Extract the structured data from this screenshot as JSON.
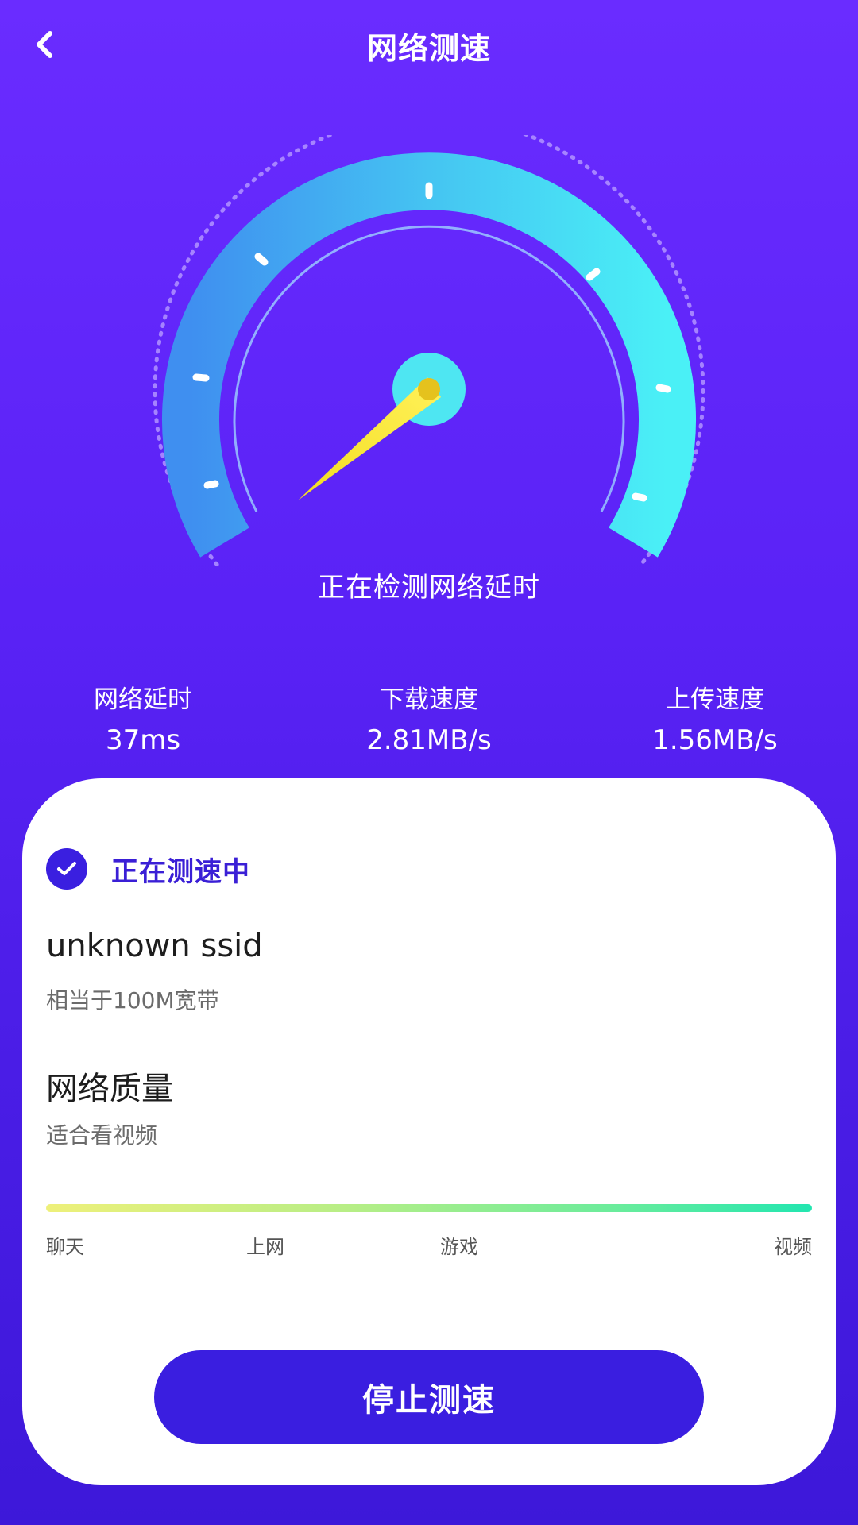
{
  "header": {
    "title": "网络测速",
    "back_icon": "chevron-left-icon"
  },
  "gauge": {
    "status": "正在检测网络延时"
  },
  "stats": [
    {
      "label": "网络延时",
      "value": "37ms"
    },
    {
      "label": "下载速度",
      "value": "2.81MB/s"
    },
    {
      "label": "上传速度",
      "value": "1.56MB/s"
    }
  ],
  "card": {
    "status_icon": "check-circle-icon",
    "status_text": "正在测速中",
    "ssid": "unknown ssid",
    "bandwidth": "相当于100M宽带",
    "quality_title": "网络质量",
    "quality_desc": "适合看视频",
    "quality_levels": [
      "聊天",
      "上网",
      "游戏",
      "视频"
    ],
    "stop_button": "停止测速"
  },
  "colors": {
    "background_top": "#6a2cff",
    "background_bottom": "#3d18d9",
    "accent": "#3a1ee0",
    "gauge_start": "#3f8ff0",
    "gauge_end": "#4af0f6",
    "needle": "#f7e83a"
  }
}
